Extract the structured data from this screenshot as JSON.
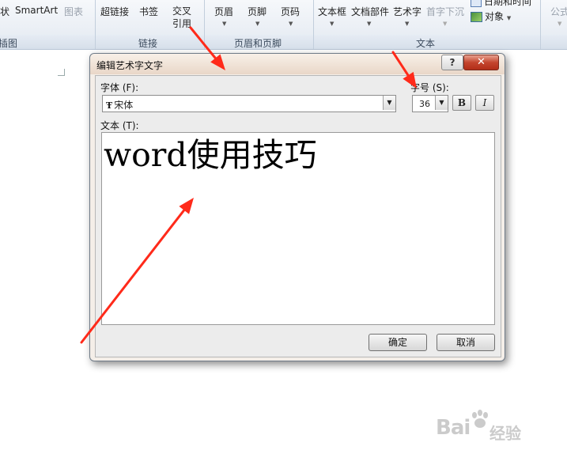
{
  "ribbon": {
    "insert_items": [
      {
        "label": "状",
        "disabled": false
      },
      {
        "label": "SmartArt",
        "disabled": false
      },
      {
        "label": "图表",
        "disabled": true
      }
    ],
    "links_items": [
      {
        "label": "超链接"
      },
      {
        "label": "书签"
      },
      {
        "label": "交叉\n引用"
      }
    ],
    "header_items": [
      {
        "label": "页眉"
      },
      {
        "label": "页脚"
      },
      {
        "label": "页码"
      }
    ],
    "text_items": [
      {
        "label": "文本框",
        "disabled": false
      },
      {
        "label": "文档部件",
        "disabled": false
      },
      {
        "label": "艺术字",
        "disabled": false
      },
      {
        "label": "首字下沉",
        "disabled": true
      }
    ],
    "date_time_label": "日期和时间",
    "object_label": "对象",
    "formula_label": "公式",
    "groups": {
      "illustrations": "插图",
      "links": "链接",
      "header_footer": "页眉和页脚",
      "text": "文本"
    }
  },
  "dialog": {
    "title": "编辑艺术字文字",
    "help_label": "?",
    "close_label": "✕",
    "font_label": "字体 (F):",
    "font_value": "宋体",
    "font_type_glyph": "Ŧ",
    "size_label": "字号 (S):",
    "size_value": "36",
    "bold_label": "B",
    "italic_label": "I",
    "text_label": "文本 (T):",
    "text_value": "word使用技巧",
    "ok_label": "确定",
    "cancel_label": "取消"
  },
  "watermark": {
    "brand": "Bai",
    "brand_suffix": "经验"
  },
  "colors": {
    "arrow": "#ff2a1a",
    "close_button": "#c4452e"
  }
}
